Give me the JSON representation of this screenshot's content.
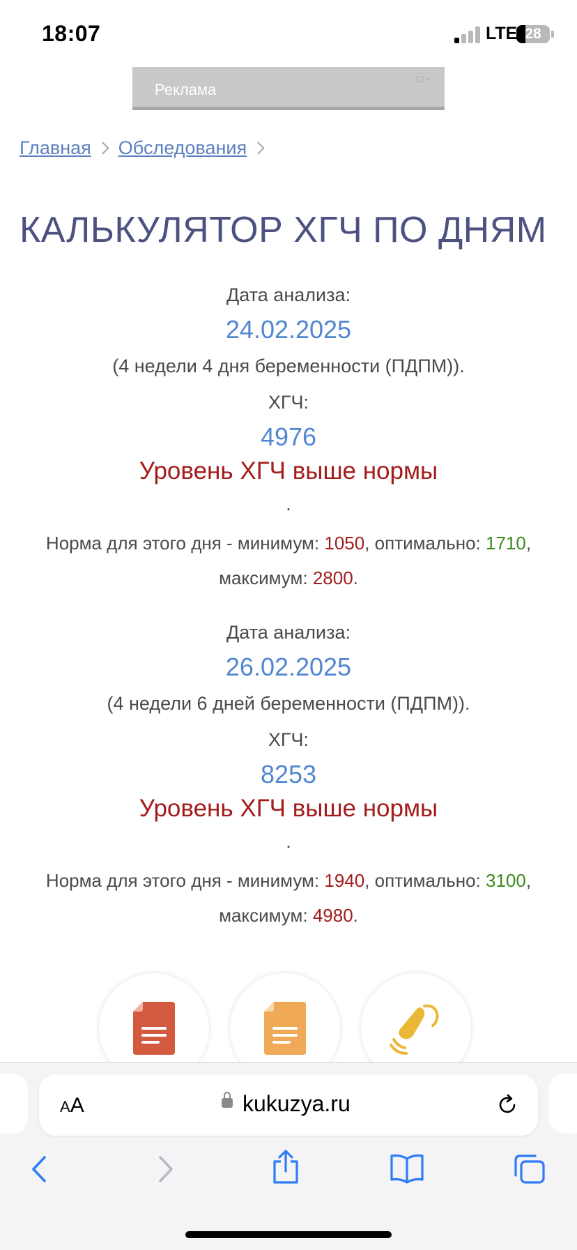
{
  "status_bar": {
    "time": "18:07",
    "network": "LTE",
    "battery": "28",
    "battery_level": 0.28
  },
  "ad": {
    "label": "Реклама",
    "age_rating": "12+"
  },
  "breadcrumb": {
    "items": [
      "Главная",
      "Обследования"
    ]
  },
  "page": {
    "title": "КАЛЬКУЛЯТОР ХГЧ ПО ДНЯМ"
  },
  "results": [
    {
      "date_label": "Дата анализа:",
      "date": "24.02.2025",
      "term": "(4 недели 4 дня беременности (ПДПМ)).",
      "hcg_label": "ХГЧ:",
      "hcg_value": "4976",
      "verdict": "Уровень ХГЧ выше нормы",
      "dot": ".",
      "norm_prefix": "Норма для этого дня - минимум: ",
      "min": "1050",
      "opt_prefix": ", оптимально: ",
      "opt": "1710",
      "comma": ",",
      "max_prefix": "максимум: ",
      "max": "2800",
      "period": "."
    },
    {
      "date_label": "Дата анализа:",
      "date": "26.02.2025",
      "term": "(4 недели 6 дней беременности (ПДПМ)).",
      "hcg_label": "ХГЧ:",
      "hcg_value": "8253",
      "verdict": "Уровень ХГЧ выше нормы",
      "dot": ".",
      "norm_prefix": "Норма для этого дня - минимум: ",
      "min": "1940",
      "opt_prefix": ", оптимально: ",
      "opt": "3100",
      "comma": ",",
      "max_prefix": "максимум: ",
      "max": "4980",
      "period": "."
    }
  ],
  "features": {
    "icons": [
      "document-red-icon",
      "document-orange-icon",
      "ultrasound-icon"
    ]
  },
  "browser": {
    "aa_small": "A",
    "aa_large": "A",
    "url": "kukuzya.ru"
  },
  "colors": {
    "title": "#4d5180",
    "link": "#5c7fc0",
    "value": "#5187d2",
    "alert": "#a31c1c",
    "optimal": "#3d8a1c"
  }
}
